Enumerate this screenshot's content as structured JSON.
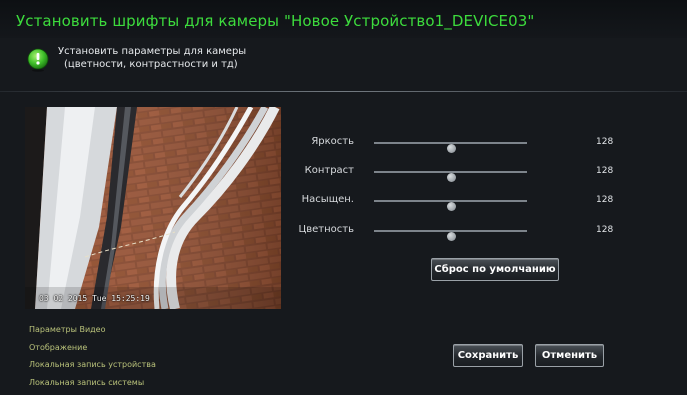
{
  "window": {
    "title": "Установить шрифты для камеры \"Новое Устройство1_DEVICE03\""
  },
  "info": {
    "line1": "Установить параметры для камеры",
    "line2": "(цветности, контрастности и тд)"
  },
  "preview": {
    "timestamp": "03 02 2015 Tue 15:25:19"
  },
  "sliders": [
    {
      "label": "Яркость",
      "value": "128",
      "fraction": 0.5
    },
    {
      "label": "Контраст",
      "value": "128",
      "fraction": 0.5
    },
    {
      "label": "Насыщен.",
      "value": "128",
      "fraction": 0.5
    },
    {
      "label": "Цветность",
      "value": "128",
      "fraction": 0.5
    }
  ],
  "buttons": {
    "reset": "Сброс по умолчанию",
    "save": "Сохранить",
    "cancel": "Отменить"
  },
  "nav": [
    "Параметры Видео",
    "Отображение",
    "Локальная запись устройства",
    "Локальная запись системы"
  ]
}
